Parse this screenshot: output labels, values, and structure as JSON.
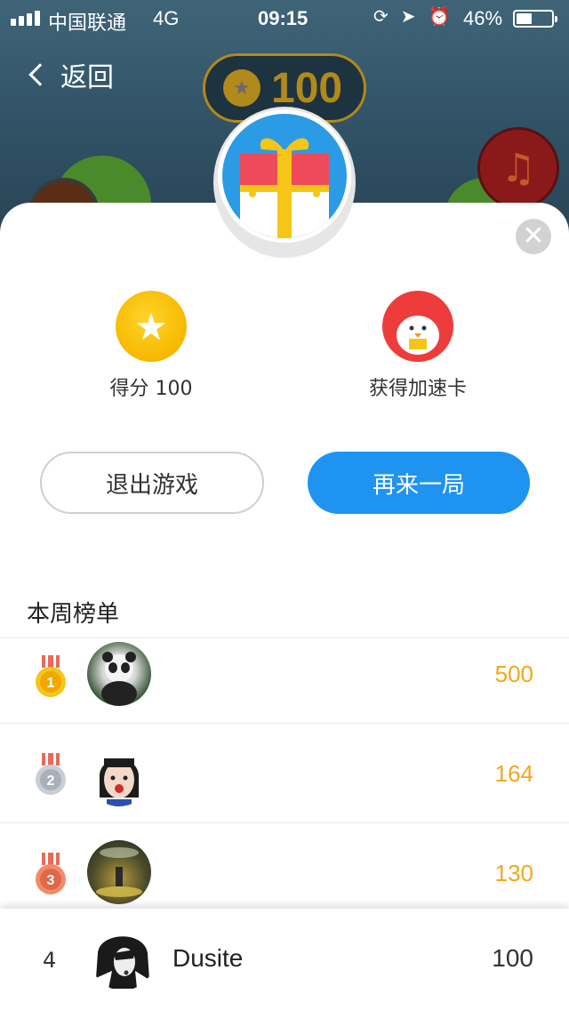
{
  "status_bar": {
    "carrier": "中国联通",
    "network": "4G",
    "time": "09:15",
    "battery": "46%",
    "battery_level": 0.46
  },
  "header": {
    "back_label": "返回",
    "coins": "100"
  },
  "rewards": {
    "score_label": "得分 100",
    "card_label": "获得加速卡"
  },
  "actions": {
    "exit_label": "退出游戏",
    "again_label": "再来一局"
  },
  "leaderboard": {
    "title": "本周榜单",
    "rows": [
      {
        "rank": "1",
        "score": "500"
      },
      {
        "rank": "2",
        "score": "164"
      },
      {
        "rank": "3",
        "score": "130"
      }
    ],
    "me": {
      "rank": "4",
      "name": "Dusite",
      "score": "100"
    }
  },
  "colors": {
    "accent": "#1f93f0",
    "score_orange": "#f3a71d",
    "gold": "#f6b800"
  },
  "icons": [
    "back-icon",
    "coin-icon",
    "music-icon",
    "gift-icon",
    "close-icon",
    "star-coin-icon",
    "chick-card-icon",
    "medal-gold-icon",
    "medal-silver-icon",
    "medal-bronze-icon"
  ]
}
